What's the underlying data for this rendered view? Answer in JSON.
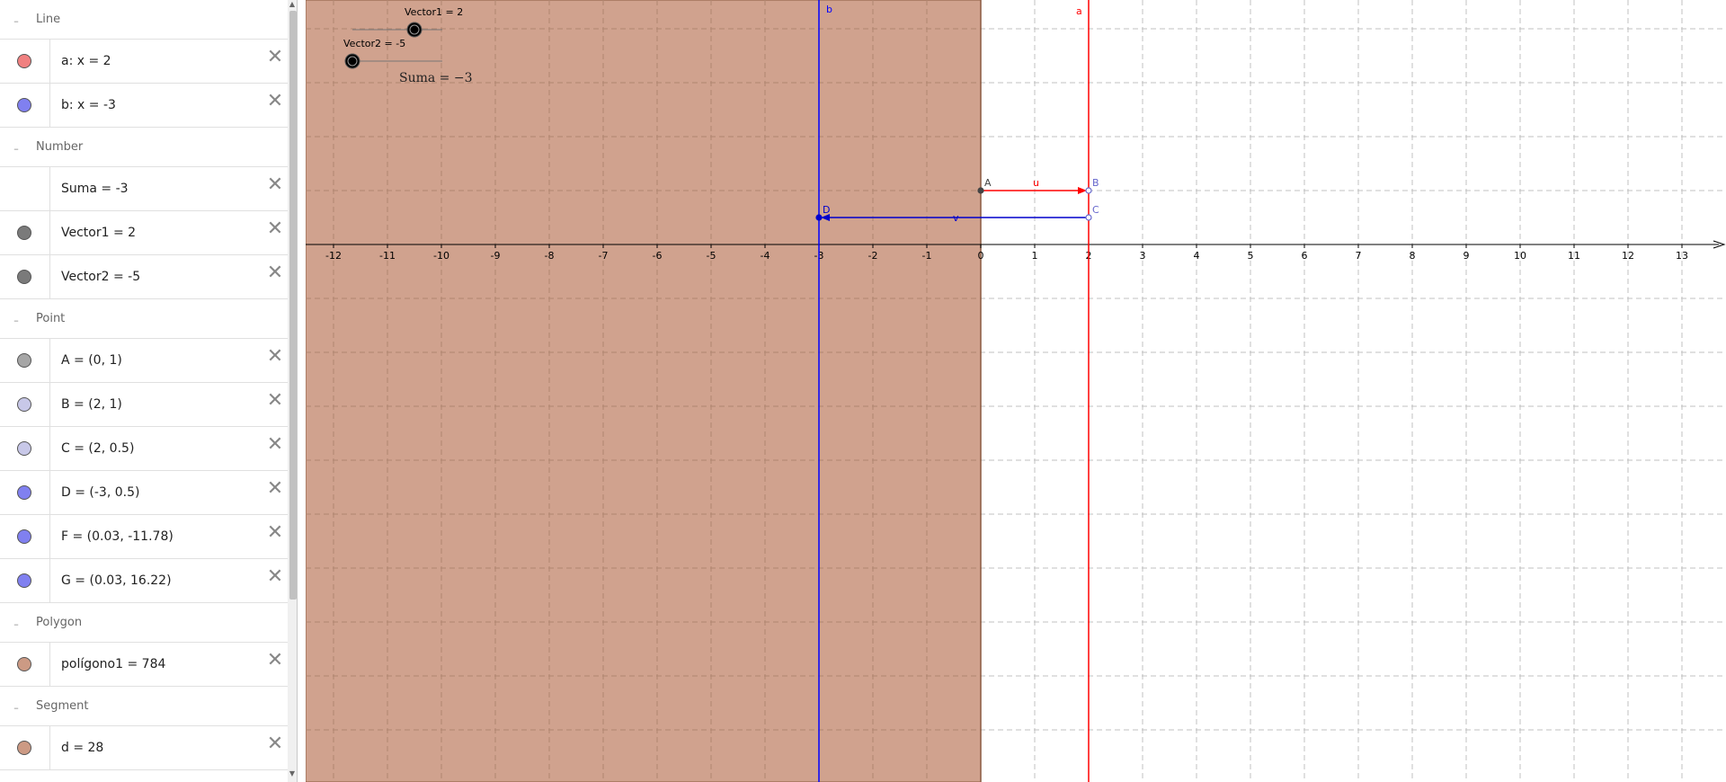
{
  "algebra": {
    "groups": [
      {
        "title": "Line",
        "items": [
          {
            "label": "a: x = 2",
            "color": "#f08080"
          },
          {
            "label": "b: x = -3",
            "color": "#8080f0"
          }
        ]
      },
      {
        "title": "Number",
        "items": [
          {
            "label": "Suma = -3",
            "color": ""
          },
          {
            "label": "Vector1 = 2",
            "color": "#7a7a7a"
          },
          {
            "label": "Vector2 = -5",
            "color": "#7a7a7a"
          }
        ]
      },
      {
        "title": "Point",
        "items": [
          {
            "label": "A = (0, 1)",
            "color": "#a6a6a6"
          },
          {
            "label": "B = (2, 1)",
            "color": "#c8c8e8"
          },
          {
            "label": "C = (2, 0.5)",
            "color": "#c8c8e8"
          },
          {
            "label": "D = (-3, 0.5)",
            "color": "#8080f0"
          },
          {
            "label": "F = (0.03, -11.78)",
            "color": "#8080f0"
          },
          {
            "label": "G = (0.03, 16.22)",
            "color": "#8080f0"
          }
        ]
      },
      {
        "title": "Polygon",
        "items": [
          {
            "label": "polígono1 = 784",
            "color": "#cc9a84"
          }
        ]
      },
      {
        "title": "Segment",
        "items": [
          {
            "label": "d = 28",
            "color": "#cc9a84"
          }
        ]
      }
    ],
    "collapse_symbol": "–",
    "close_symbol": "✕"
  },
  "graphics": {
    "xmin": -12,
    "xmax": 13,
    "x_ticks": [
      -12,
      -11,
      -10,
      -9,
      -8,
      -7,
      -6,
      -5,
      -4,
      -3,
      -2,
      -1,
      0,
      1,
      2,
      3,
      4,
      5,
      6,
      7,
      8,
      9,
      10,
      11,
      12,
      13
    ],
    "polygon_color": "#cc9a84",
    "line_a": {
      "label": "a",
      "x": 2,
      "color": "#ff0000"
    },
    "line_b": {
      "label": "b",
      "x": -3,
      "color": "#0000ff"
    },
    "points": [
      {
        "label": "A",
        "x": 0,
        "y": 1,
        "color": "#444444"
      },
      {
        "label": "B",
        "x": 2,
        "y": 1,
        "color": "#6666cc"
      },
      {
        "label": "C",
        "x": 2,
        "y": 0.5,
        "color": "#6666cc"
      },
      {
        "label": "D",
        "x": -3,
        "y": 0.5,
        "color": "#0000cc"
      }
    ],
    "vector_u": {
      "label": "u",
      "color": "#ff0000"
    },
    "vector_v": {
      "label": "v",
      "color": "#0000cc"
    },
    "slider1": {
      "label": "Vector1 = 2"
    },
    "slider2": {
      "label": "Vector2 = -5"
    },
    "suma_text": "Suma  =  −3"
  }
}
